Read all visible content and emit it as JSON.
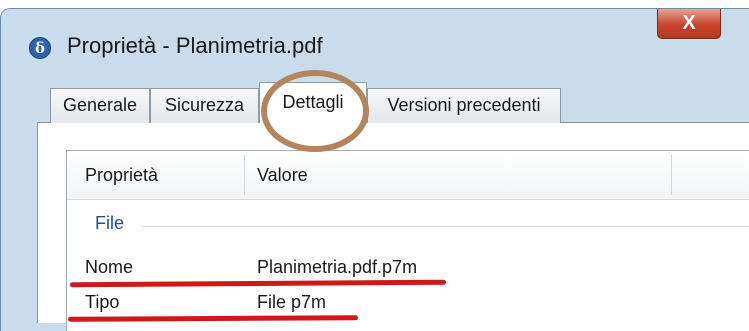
{
  "window": {
    "title": "Proprietà - Planimetria.pdf",
    "app_icon_glyph": "δ",
    "close_glyph": "X"
  },
  "tabs": [
    {
      "label": "Generale",
      "active": false
    },
    {
      "label": "Sicurezza",
      "active": false
    },
    {
      "label": "Dettagli",
      "active": true
    },
    {
      "label": "Versioni precedenti",
      "active": false
    }
  ],
  "list": {
    "columns": [
      "Proprietà",
      "Valore"
    ],
    "group": "File",
    "rows": [
      {
        "property": "Nome",
        "value": "Planimetria.pdf.p7m"
      },
      {
        "property": "Tipo",
        "value": "File p7m"
      }
    ]
  },
  "colors": {
    "highlight_circle": "#b4845c",
    "underline": "#d01818",
    "group_label": "#1f4e9e"
  }
}
